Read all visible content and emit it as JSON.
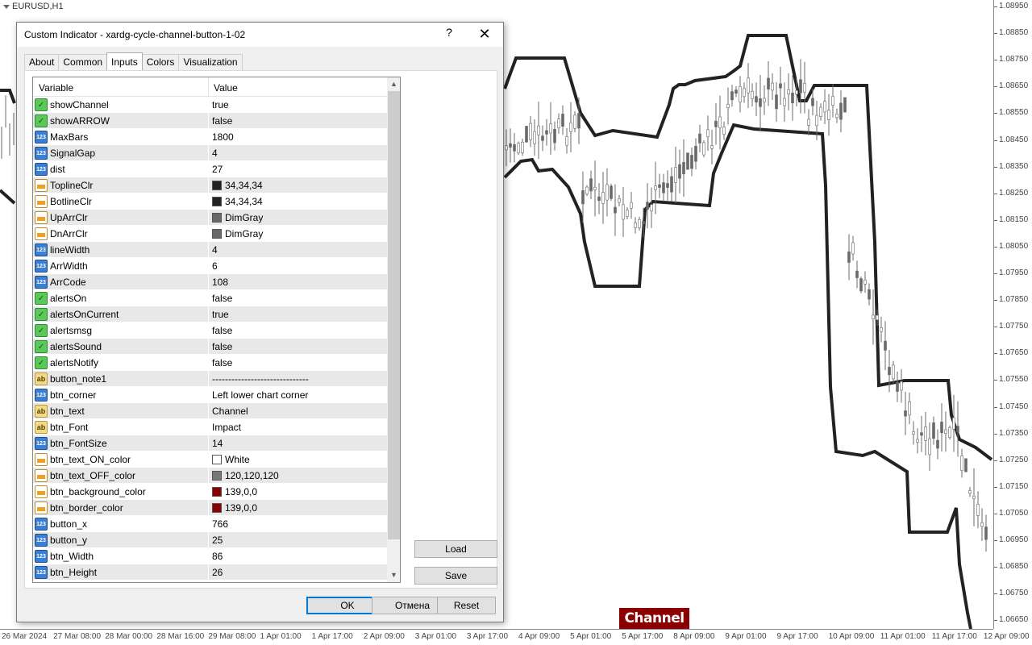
{
  "chart": {
    "symbol": "EURUSD,H1",
    "price_ticks": [
      "1.08950",
      "1.08850",
      "1.08750",
      "1.08650",
      "1.08550",
      "1.08450",
      "1.08350",
      "1.08250",
      "1.08150",
      "1.08050",
      "1.07950",
      "1.07850",
      "1.07750",
      "1.07650",
      "1.07550",
      "1.07450",
      "1.07350",
      "1.07250",
      "1.07150",
      "1.07050",
      "1.06950",
      "1.06850",
      "1.06750",
      "1.06650"
    ],
    "time_ticks": [
      "26 Mar 2024",
      "27 Mar 08:00",
      "28 Mar 00:00",
      "28 Mar 16:00",
      "29 Mar 08:00",
      "1 Apr 01:00",
      "1 Apr 17:00",
      "2 Apr 09:00",
      "3 Apr 01:00",
      "3 Apr 17:00",
      "4 Apr 09:00",
      "5 Apr 01:00",
      "5 Apr 17:00",
      "8 Apr 09:00",
      "9 Apr 01:00",
      "9 Apr 17:00",
      "10 Apr 09:00",
      "11 Apr 01:00",
      "11 Apr 17:00",
      "12 Apr 09:00"
    ],
    "channel_button_label": "Channel",
    "colors": {
      "channel_line": "#222222",
      "candles": "#696969",
      "button_bg": "#8b0000",
      "button_text": "#ffffff"
    }
  },
  "dialog": {
    "title": "Custom Indicator - xardg-cycle-channel-button-1-02",
    "help_label": "?",
    "close_label": "✕",
    "tabs": [
      {
        "label": "About"
      },
      {
        "label": "Common"
      },
      {
        "label": "Inputs",
        "active": true
      },
      {
        "label": "Colors"
      },
      {
        "label": "Visualization"
      }
    ],
    "grid": {
      "col_variable": "Variable",
      "col_value": "Value",
      "rows": [
        {
          "type": "bool",
          "name": "showChannel",
          "value": "true"
        },
        {
          "type": "bool",
          "name": "showARROW",
          "value": "false"
        },
        {
          "type": "num",
          "name": "MaxBars",
          "value": "1800"
        },
        {
          "type": "num",
          "name": "SignalGap",
          "value": "4"
        },
        {
          "type": "num",
          "name": "dist",
          "value": "27"
        },
        {
          "type": "clr",
          "name": "ToplineClr",
          "value": "34,34,34",
          "swatch": "#222222"
        },
        {
          "type": "clr",
          "name": "BotlineClr",
          "value": "34,34,34",
          "swatch": "#222222"
        },
        {
          "type": "clr",
          "name": "UpArrClr",
          "value": "DimGray",
          "swatch": "#696969"
        },
        {
          "type": "clr",
          "name": "DnArrClr",
          "value": "DimGray",
          "swatch": "#696969"
        },
        {
          "type": "num",
          "name": "lineWidth",
          "value": "4"
        },
        {
          "type": "num",
          "name": "ArrWidth",
          "value": "6"
        },
        {
          "type": "num",
          "name": "ArrCode",
          "value": "108"
        },
        {
          "type": "bool",
          "name": "alertsOn",
          "value": "false"
        },
        {
          "type": "bool",
          "name": "alertsOnCurrent",
          "value": "true"
        },
        {
          "type": "bool",
          "name": "alertsmsg",
          "value": "false"
        },
        {
          "type": "bool",
          "name": "alertsSound",
          "value": "false"
        },
        {
          "type": "bool",
          "name": "alertsNotify",
          "value": "false"
        },
        {
          "type": "str",
          "name": "button_note1",
          "value": "------------------------------"
        },
        {
          "type": "num",
          "name": "btn_corner",
          "value": "Left lower chart corner"
        },
        {
          "type": "str",
          "name": "btn_text",
          "value": "Channel"
        },
        {
          "type": "str",
          "name": "btn_Font",
          "value": "Impact"
        },
        {
          "type": "num",
          "name": "btn_FontSize",
          "value": "14"
        },
        {
          "type": "clr",
          "name": "btn_text_ON_color",
          "value": "White",
          "swatch": "#ffffff"
        },
        {
          "type": "clr",
          "name": "btn_text_OFF_color",
          "value": "120,120,120",
          "swatch": "#787878"
        },
        {
          "type": "clr",
          "name": "btn_background_color",
          "value": "139,0,0",
          "swatch": "#8b0000"
        },
        {
          "type": "clr",
          "name": "btn_border_color",
          "value": "139,0,0",
          "swatch": "#8b0000"
        },
        {
          "type": "num",
          "name": "button_x",
          "value": "766"
        },
        {
          "type": "num",
          "name": "button_y",
          "value": "25"
        },
        {
          "type": "num",
          "name": "btn_Width",
          "value": "86"
        },
        {
          "type": "num",
          "name": "btn_Height",
          "value": "26"
        }
      ]
    },
    "load_label": "Load",
    "save_label": "Save",
    "ok_label": "OK",
    "cancel_label": "Отмена",
    "reset_label": "Reset",
    "icon_labels": {
      "num": "123",
      "str": "ab"
    }
  }
}
